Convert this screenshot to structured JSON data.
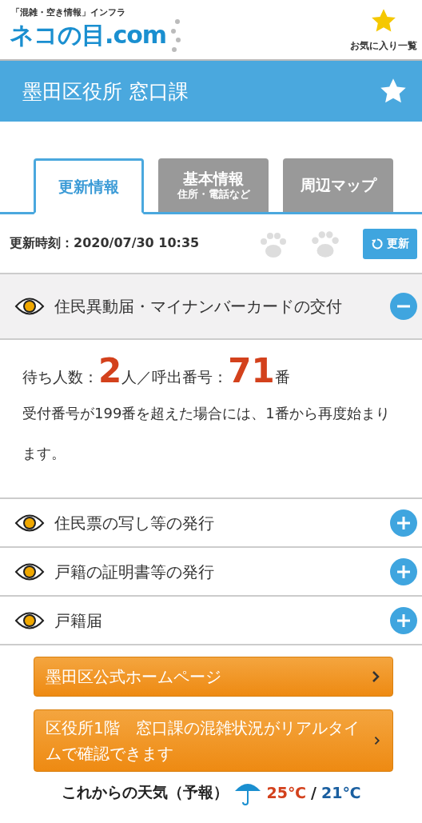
{
  "header": {
    "tagline": "「混雑・空き情報」インフラ",
    "logo": "ネコの目.com",
    "favorites": "お気に入り一覧"
  },
  "title_bar": {
    "title": "墨田区役所 窓口課",
    "favorite": false
  },
  "tabs": [
    {
      "label": "更新情報",
      "selected": true
    },
    {
      "label": "基本情報",
      "sub": "住所・電話など",
      "selected": false
    },
    {
      "label": "周辺マップ",
      "selected": false
    }
  ],
  "update": {
    "label": "更新時刻：2020/07/30 10:35",
    "button": "更新"
  },
  "sections": [
    {
      "title": "住民異動届・マイナンバーカードの交付",
      "expanded": true,
      "wait_label": "待ち人数：",
      "wait_count": "2",
      "wait_unit": "人／呼出番号：",
      "call_number": "71",
      "call_unit": "番",
      "note": "受付番号が199番を超えた場合には、1番から再度始まります。"
    },
    {
      "title": "住民票の写し等の発行",
      "expanded": false
    },
    {
      "title": "戸籍の証明書等の発行",
      "expanded": false
    },
    {
      "title": "戸籍届",
      "expanded": false
    }
  ],
  "links": [
    "墨田区公式ホームページ",
    "区役所1階　窓口課の混雑状況がリアルタイムで確認できます"
  ],
  "weather": {
    "label": "これからの天気（予報）",
    "high": "25℃",
    "separator": "/",
    "low": "21℃"
  }
}
